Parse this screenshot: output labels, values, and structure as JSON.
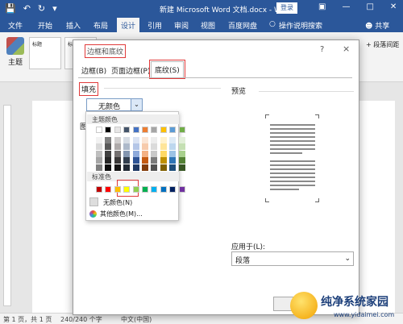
{
  "app": {
    "qat_icons": [
      "save-icon",
      "undo-icon",
      "redo-icon",
      "customize-icon"
    ],
    "title": "新建 Microsoft Word 文档.docx - Word",
    "login": "登录",
    "window_controls": [
      "restore-ribbon-icon",
      "minimize-icon",
      "maximize-icon",
      "close-icon"
    ]
  },
  "ribbon": {
    "tabs": [
      "文件",
      "开始",
      "插入",
      "布局",
      "设计",
      "引用",
      "审阅",
      "视图",
      "百度网盘",
      "操作说明搜索"
    ],
    "active_tab": "设计",
    "share": "共享",
    "theme_button": "主题",
    "style_labels": [
      "标题",
      "标题 1"
    ],
    "right_partial": "+ 段落间距"
  },
  "status": {
    "page": "第 1 页，共 1 页",
    "words": "240/240 个字",
    "lang": "中文(中国)"
  },
  "dialog": {
    "title": "边框和底纹",
    "help": "?",
    "close": "×",
    "tabs": [
      "边框(B)",
      "页面边框(P)",
      "底纹(S)"
    ],
    "active_tab": "底纹(S)",
    "fill_label": "填充",
    "fill_value": "无颜色",
    "pattern_partial": "图",
    "preview_label": "预览",
    "apply_to_label": "应用于(L):",
    "apply_to_value": "段落"
  },
  "color_picker": {
    "theme_header": "主题颜色",
    "standard_header": "标准色",
    "no_color": "无颜色(N)",
    "more_colors": "其他颜色(M)...",
    "theme_colors": [
      "#ffffff",
      "#000000",
      "#e7e6e6",
      "#44546a",
      "#4472c4",
      "#ed7d31",
      "#a5a5a5",
      "#ffc000",
      "#5b9bd5",
      "#70ad47"
    ],
    "theme_shades": [
      [
        "#f2f2f2",
        "#d9d9d9",
        "#bfbfbf",
        "#a6a6a6",
        "#808080"
      ],
      [
        "#7f7f7f",
        "#595959",
        "#404040",
        "#262626",
        "#0d0d0d"
      ],
      [
        "#d0cece",
        "#aeaaaa",
        "#757171",
        "#3a3838",
        "#171616"
      ],
      [
        "#d6dce4",
        "#adb9ca",
        "#8496b0",
        "#333f4f",
        "#222a35"
      ],
      [
        "#d9e2f3",
        "#b4c6e7",
        "#8eaadb",
        "#2f5496",
        "#1f3864"
      ],
      [
        "#fbe5d5",
        "#f7cbac",
        "#f4b183",
        "#c55a11",
        "#833c0b"
      ],
      [
        "#ededed",
        "#dbdbdb",
        "#c9c9c9",
        "#7b7b7b",
        "#525252"
      ],
      [
        "#fff2cc",
        "#fee599",
        "#ffd965",
        "#bf9000",
        "#7f6000"
      ],
      [
        "#deebf6",
        "#bdd7ee",
        "#9cc3e5",
        "#2e75b5",
        "#1e4e79"
      ],
      [
        "#e2efd9",
        "#c5e0b3",
        "#a8d08d",
        "#538135",
        "#375623"
      ]
    ],
    "standard_colors": [
      "#c00000",
      "#ff0000",
      "#ffc000",
      "#ffff00",
      "#92d050",
      "#00b050",
      "#00b0f0",
      "#0070c0",
      "#002060",
      "#7030a0"
    ],
    "highlighted_standard_index": 4
  },
  "watermark": {
    "main": "纯净系统家园",
    "url": "www.yidaimei.com"
  }
}
